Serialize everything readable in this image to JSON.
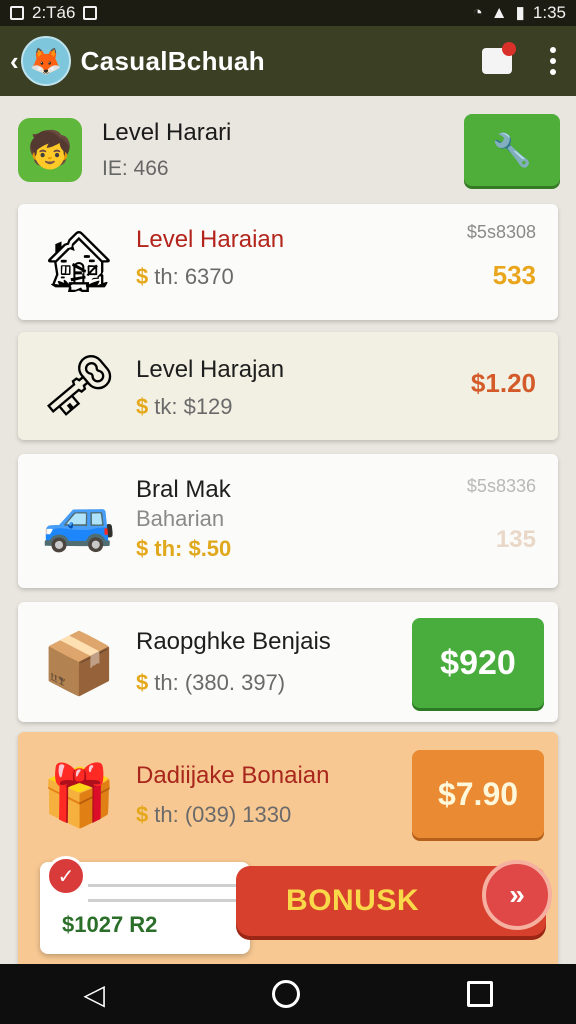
{
  "status_bar": {
    "time": "2:Tá6",
    "battery_time": "1:35"
  },
  "app_bar": {
    "title": "CasualBchuah",
    "avatar_icon": "fox-icon",
    "back_icon": "back-chevron-icon"
  },
  "level_header": {
    "title": "Level Harari",
    "subtitle": "IE: 466",
    "tool_icon": "wrench-icon"
  },
  "items": [
    {
      "name": "Level Haraian",
      "sub": "th: 6370",
      "price_top": "$5s8308",
      "price": "533",
      "icon": "treasure-house-icon",
      "price_color": "#e9a51c"
    },
    {
      "name": "Level Harajan",
      "sub": "tk: $129",
      "price": "$1.20",
      "icon": "green-key-icon",
      "price_color": "#d45a2a"
    },
    {
      "name": "Bral Mak",
      "sub2": "Baharian",
      "sub": "th: $.50",
      "price_top": "$5s8336",
      "price": "135",
      "icon": "robot-car-icon",
      "price_color": "#e9d8c8"
    },
    {
      "name": "Raopghke Benjais",
      "sub": "th: (380. 397)",
      "buy_label": "$920",
      "icon": "crate-icon"
    },
    {
      "name": "Dadiijake Bonaian",
      "sub": "th: (039) 1330",
      "buy_label": "$7.90",
      "icon": "gift-character-icon"
    }
  ],
  "promo": {
    "value": "$1027 R2",
    "bonus_label": "BONUSK",
    "skip_label": "»"
  },
  "colors": {
    "appbar": "#3b3f24",
    "green": "#49ad3d",
    "orange": "#ea8a32",
    "red": "#d7402c"
  }
}
